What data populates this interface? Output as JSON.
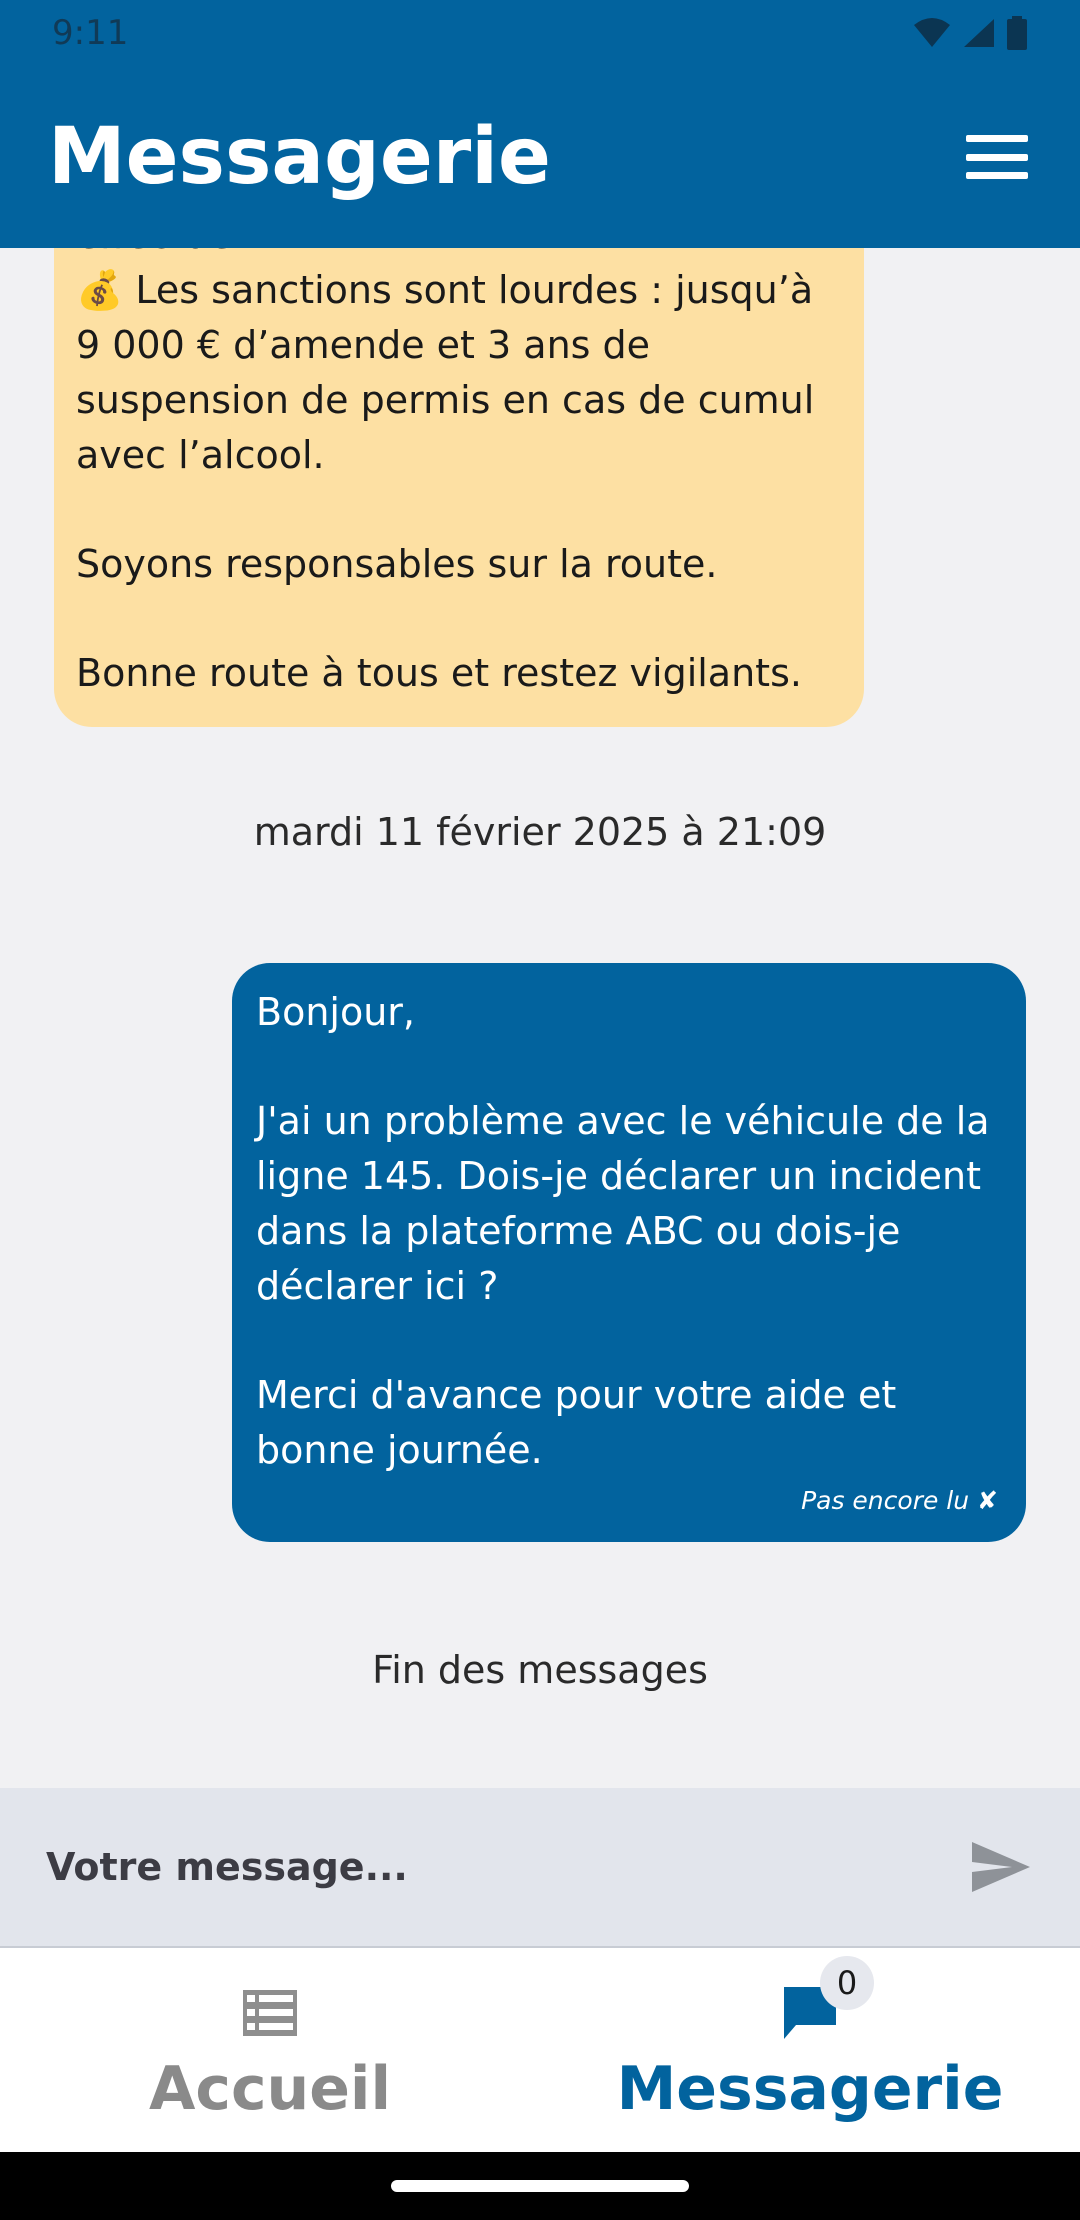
{
  "status_bar": {
    "time": "9:11"
  },
  "app_bar": {
    "title": "Messagerie"
  },
  "messages": {
    "received": {
      "lines": [
        "effectué.",
        "💰 Les sanctions sont lourdes : jusqu’à 9 000 € d’amende et 3 ans de suspension de permis en cas de cumul avec l’alcool."
      ],
      "para2": "Soyons responsables sur la route.",
      "para3": "Bonne route à tous et restez vigilants."
    },
    "date_separator": "mardi 11 février 2025 à 21:09",
    "sent": {
      "greeting": "Bonjour,",
      "body": "J'ai un problème avec le véhicule de la ligne 145. Dois-je déclarer un incident dans la plateforme ABC ou dois-je déclarer ici ?",
      "closing": "Merci d'avance pour votre aide et bonne journée.",
      "status": "Pas encore lu ✘"
    },
    "end_label": "Fin des messages"
  },
  "composer": {
    "placeholder": "Votre message..."
  },
  "bottom_nav": {
    "items": [
      {
        "label": "Accueil",
        "icon": "list-icon",
        "active": false
      },
      {
        "label": "Messagerie",
        "icon": "chat-icon",
        "active": true,
        "badge": "0"
      }
    ]
  },
  "colors": {
    "primary": "#02639e",
    "received_bubble": "#fde0a3",
    "composer_bg": "#e2e5ec"
  }
}
